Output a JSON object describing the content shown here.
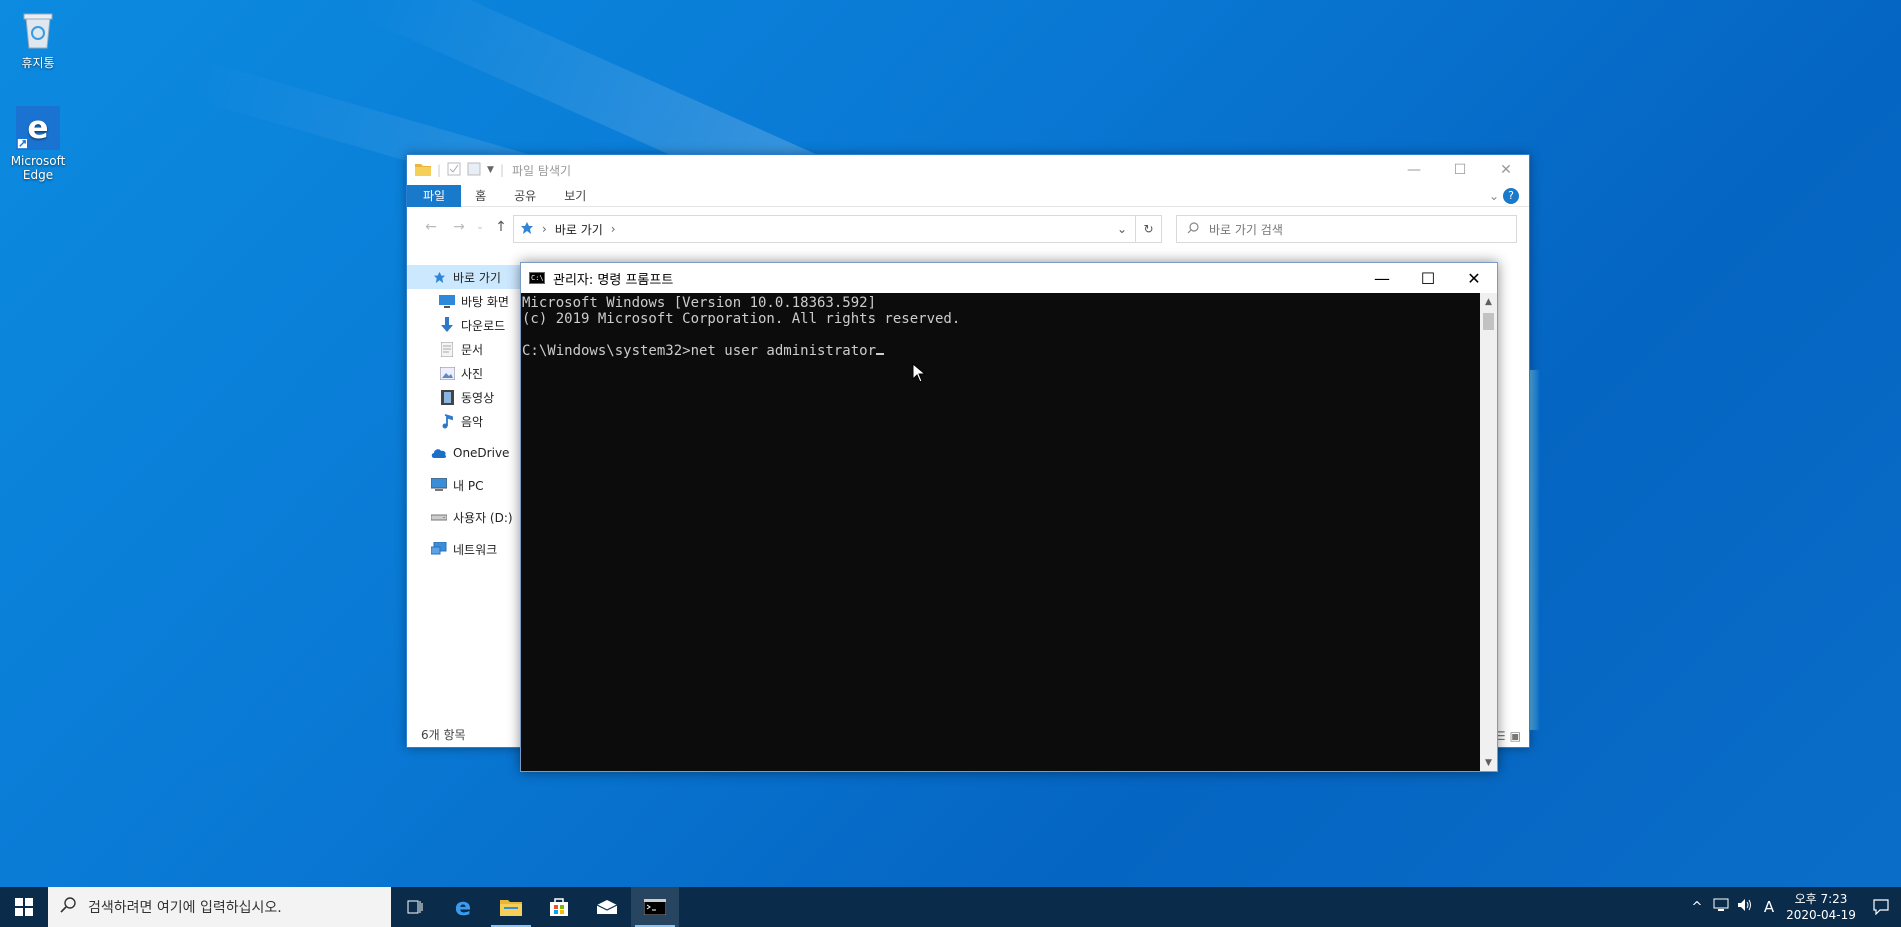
{
  "desktop": {
    "icons": [
      {
        "label": "휴지통"
      },
      {
        "label": "Microsoft Edge"
      }
    ]
  },
  "explorer": {
    "title": "파일 탐색기",
    "ribbon_tabs": [
      "파일",
      "홈",
      "공유",
      "보기"
    ],
    "help": "?",
    "address": "바로 가기",
    "search_placeholder": "바로 가기 검색",
    "nav": [
      {
        "label": "바로 가기",
        "icon": "pin-icon"
      },
      {
        "label": "바탕 화면",
        "icon": "desktop-icon"
      },
      {
        "label": "다운로드",
        "icon": "download-icon"
      },
      {
        "label": "문서",
        "icon": "document-icon"
      },
      {
        "label": "사진",
        "icon": "pictures-icon"
      },
      {
        "label": "동영상",
        "icon": "video-icon"
      },
      {
        "label": "음악",
        "icon": "music-icon"
      },
      {
        "label": "OneDrive",
        "icon": "cloud-icon"
      },
      {
        "label": "내 PC",
        "icon": "pc-icon"
      },
      {
        "label": "사용자 (D:)",
        "icon": "drive-icon"
      },
      {
        "label": "네트워크",
        "icon": "network-icon"
      }
    ],
    "status": "6개 항목"
  },
  "cmd": {
    "title": "관리자: 명령 프롬프트",
    "lines": [
      "Microsoft Windows [Version 10.0.18363.592]",
      "(c) 2019 Microsoft Corporation. All rights reserved.",
      "",
      "C:\\Windows\\system32>net user administrator"
    ]
  },
  "taskbar": {
    "search_placeholder": "검색하려면 여기에 입력하십시오.",
    "ime": "A",
    "time": "오후 7:23",
    "date": "2020-04-19"
  },
  "colors": {
    "accent": "#1979ca",
    "taskbar": "#0a2b4a",
    "console_bg": "#0c0c0c",
    "console_fg": "#cccccc"
  }
}
